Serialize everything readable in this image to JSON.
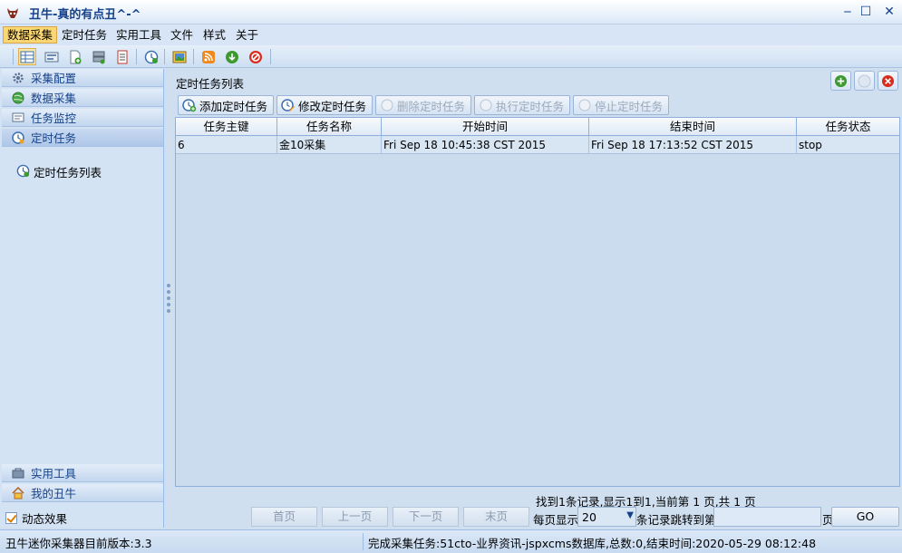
{
  "window": {
    "title": "丑牛-真的有点丑^-^",
    "minimize": "‒",
    "maximize": "☐",
    "close": "✕"
  },
  "menubar": {
    "items": [
      {
        "label": "数据采集",
        "active": true
      },
      {
        "label": "定时任务"
      },
      {
        "label": "实用工具"
      },
      {
        "label": "文件"
      },
      {
        "label": "样式"
      },
      {
        "label": "关于"
      }
    ]
  },
  "toolbar": {
    "icons": [
      "grid-icon",
      "form-icon",
      "page-add-icon",
      "server-icon",
      "table-icon",
      "clock-refresh-icon",
      "image-icon",
      "rss-icon",
      "go-arrow-icon",
      "stop-icon"
    ]
  },
  "sidebar": {
    "headers": [
      {
        "label": "采集配置",
        "icon": "gear-icon"
      },
      {
        "label": "数据采集",
        "icon": "globe-icon"
      },
      {
        "label": "任务监控",
        "icon": "monitor-icon"
      },
      {
        "label": "定时任务",
        "icon": "clock-icon",
        "selected": true
      }
    ],
    "tree": {
      "label": "定时任务列表"
    },
    "bottom": [
      {
        "label": "实用工具",
        "icon": "tools-icon"
      },
      {
        "label": "我的丑牛",
        "icon": "home-icon"
      }
    ],
    "effect_label": "动态效果",
    "effect_checked": true
  },
  "panel": {
    "title": "定时任务列表",
    "corner_buttons": [
      "add-circle-icon",
      "refresh-circle-icon",
      "delete-circle-icon"
    ]
  },
  "actions": {
    "add": "添加定时任务",
    "edit": "修改定时任务",
    "delete": "删除定时任务",
    "run": "执行定时任务",
    "stop": "停止定时任务"
  },
  "grid": {
    "columns": [
      "任务主键",
      "任务名称",
      "开始时间",
      "结束时间",
      "任务状态"
    ],
    "rows": [
      [
        "6",
        "金10采集",
        "Fri Sep 18 10:45:38 CST 2015",
        "Fri Sep 18 17:13:52 CST 2015",
        "stop"
      ]
    ]
  },
  "pager": {
    "info": "找到1条记录,显示1到1,当前第 1 页,共 1 页",
    "first": "首页",
    "prev": "上一页",
    "next": "下一页",
    "last": "末页",
    "page_size_label": "每页显示",
    "page_size": "20",
    "jump_label": "条记录跳转到第",
    "page_suffix": "页",
    "go": "GO"
  },
  "status": {
    "left": "丑牛迷你采集器目前版本:3.3",
    "right": "完成采集任务:51cto-业界资讯-jspxcms数据库,总数:0,结束时间:2020-05-29 08:12:48"
  }
}
